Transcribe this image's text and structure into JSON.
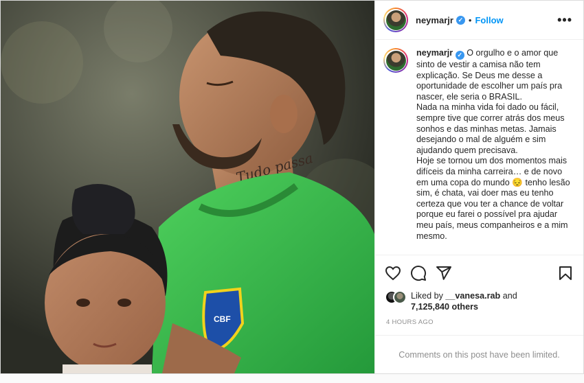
{
  "header": {
    "username": "neymarjr",
    "verified_mark": "✓",
    "separator": "•",
    "follow_label": "Follow",
    "more_label": "•••"
  },
  "caption": {
    "username": "neymarjr",
    "text": "O orgulho e o amor que sinto de vestir a camisa não tem explicação. Se Deus me desse a oportunidade de escolher um país pra nascer, ele seria o BRASIL.\nNada na minha vida foi dado ou fácil, sempre tive que correr atrás dos meus sonhos e das minhas metas. Jamais desejando o mal de alguém e sim ajudando quem precisava.\nHoje se tornou um dos momentos mais difíceis da minha carreira… e de novo em uma copa do mundo 😔 tenho lesão sim, é chata, vai doer mas eu tenho certeza que vou ter a chance de voltar porque eu farei o possível pra ajudar meu país, meus companheiros e a mim mesmo."
  },
  "actions": {
    "icons": [
      "heart-icon",
      "comment-icon",
      "share-icon",
      "bookmark-icon"
    ]
  },
  "likes": {
    "prefix": "Liked by ",
    "liker": "__vanesa.rab",
    "and": " and",
    "count": "7,125,840 others"
  },
  "timestamp": "4 HOURS AGO",
  "comments_notice": "Comments on this post have been limited.",
  "photo": {
    "tattoo_text": "Tudo passa",
    "crest_text": "CBF"
  },
  "colors": {
    "follow": "#0095f6",
    "verified": "#3897f0",
    "jersey": "#3fbf4f",
    "muted": "#8e8e8e"
  }
}
